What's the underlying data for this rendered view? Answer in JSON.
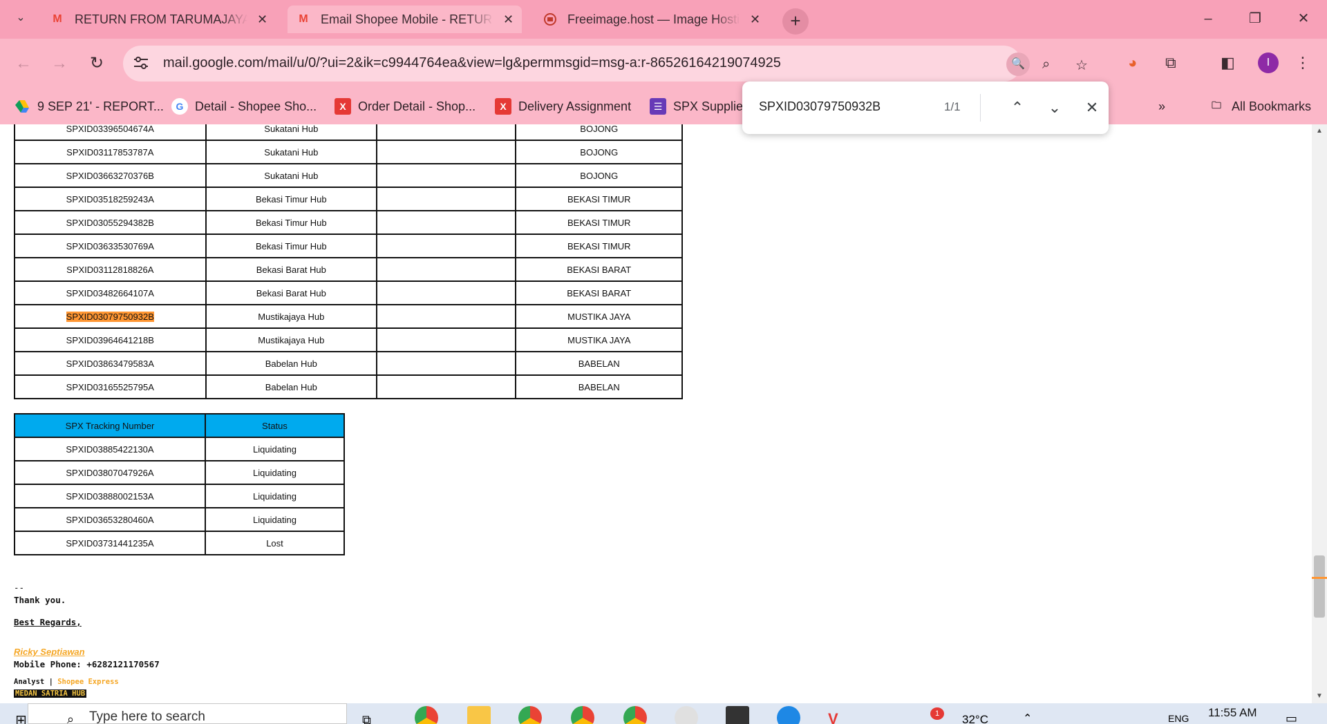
{
  "tabs": [
    {
      "label": "RETURN FROM TARUMAJAYA H",
      "favicon": "gmail-icon"
    },
    {
      "label": "Email Shopee Mobile - RETURN",
      "favicon": "gmail-icon"
    },
    {
      "label": "Freeimage.host — Image Hostin",
      "favicon": "freeimage-icon"
    }
  ],
  "address": {
    "url": "mail.google.com/mail/u/0/?ui=2&ik=c9944764ea&view=lg&permmsgid=msg-a:r-86526164219074925"
  },
  "profile_initial": "I",
  "bookmarks": [
    {
      "label": "9 SEP 21' - REPORT...",
      "icon": "drive-icon"
    },
    {
      "label": "Detail - Shopee Sho...",
      "icon": "google-icon"
    },
    {
      "label": "Order Detail - Shop...",
      "icon": "x-icon"
    },
    {
      "label": "Delivery Assignment",
      "icon": "x-icon"
    },
    {
      "label": "SPX Supplies",
      "icon": "forms-icon"
    }
  ],
  "bookmarks_more": "All Bookmarks",
  "find": {
    "query": "SPXID03079750932B",
    "count": "1/1"
  },
  "route_table": {
    "rows": [
      {
        "tracking": "SPXID03396504674A",
        "hub": "Sukatani Hub",
        "note": "",
        "area": "BOJONG"
      },
      {
        "tracking": "SPXID03117853787A",
        "hub": "Sukatani Hub",
        "note": "",
        "area": "BOJONG"
      },
      {
        "tracking": "SPXID03663270376B",
        "hub": "Sukatani Hub",
        "note": "",
        "area": "BOJONG"
      },
      {
        "tracking": "SPXID03518259243A",
        "hub": "Bekasi Timur Hub",
        "note": "",
        "area": "BEKASI TIMUR"
      },
      {
        "tracking": "SPXID03055294382B",
        "hub": "Bekasi Timur Hub",
        "note": "",
        "area": "BEKASI TIMUR"
      },
      {
        "tracking": "SPXID03633530769A",
        "hub": "Bekasi Timur Hub",
        "note": "",
        "area": "BEKASI TIMUR"
      },
      {
        "tracking": "SPXID03112818826A",
        "hub": "Bekasi Barat Hub",
        "note": "",
        "area": "BEKASI BARAT"
      },
      {
        "tracking": "SPXID03482664107A",
        "hub": "Bekasi Barat Hub",
        "note": "",
        "area": "BEKASI BARAT"
      },
      {
        "tracking": "SPXID03079750932B",
        "hub": "Mustikajaya Hub",
        "note": "",
        "area": "MUSTIKA JAYA",
        "highlight": true
      },
      {
        "tracking": "SPXID03964641218B",
        "hub": "Mustikajaya Hub",
        "note": "",
        "area": "MUSTIKA JAYA"
      },
      {
        "tracking": "SPXID03863479583A",
        "hub": "Babelan Hub",
        "note": "",
        "area": "BABELAN"
      },
      {
        "tracking": "SPXID03165525795A",
        "hub": "Babelan Hub",
        "note": "",
        "area": "BABELAN"
      }
    ]
  },
  "status_table": {
    "headers": [
      "SPX Tracking Number",
      "Status"
    ],
    "rows": [
      {
        "tracking": "SPXID03885422130A",
        "status": "Liquidating"
      },
      {
        "tracking": "SPXID03807047926A",
        "status": "Liquidating"
      },
      {
        "tracking": "SPXID03888002153A",
        "status": "Liquidating"
      },
      {
        "tracking": "SPXID03653280460A",
        "status": "Liquidating"
      },
      {
        "tracking": "SPXID03731441235A",
        "status": "Lost"
      }
    ]
  },
  "signature": {
    "dashes": "--",
    "thanks": "Thank you.",
    "regards": "Best Regards,",
    "name": "Ricky Septiawan",
    "phone": "Mobile Phone: +6282121170567",
    "role_prefix": "Analyst | ",
    "company": "Shopee Express",
    "hub": "MEDAN SATRIA HUB"
  },
  "taskbar": {
    "search_placeholder": "Type here to search",
    "temperature": "32°C",
    "language": "ENG",
    "time": "11:55 AM",
    "notification_count": "1"
  },
  "colors": {
    "chrome_pink": "#f8a1b8",
    "find_highlight": "#ff9632",
    "status_header": "#00aaee"
  }
}
